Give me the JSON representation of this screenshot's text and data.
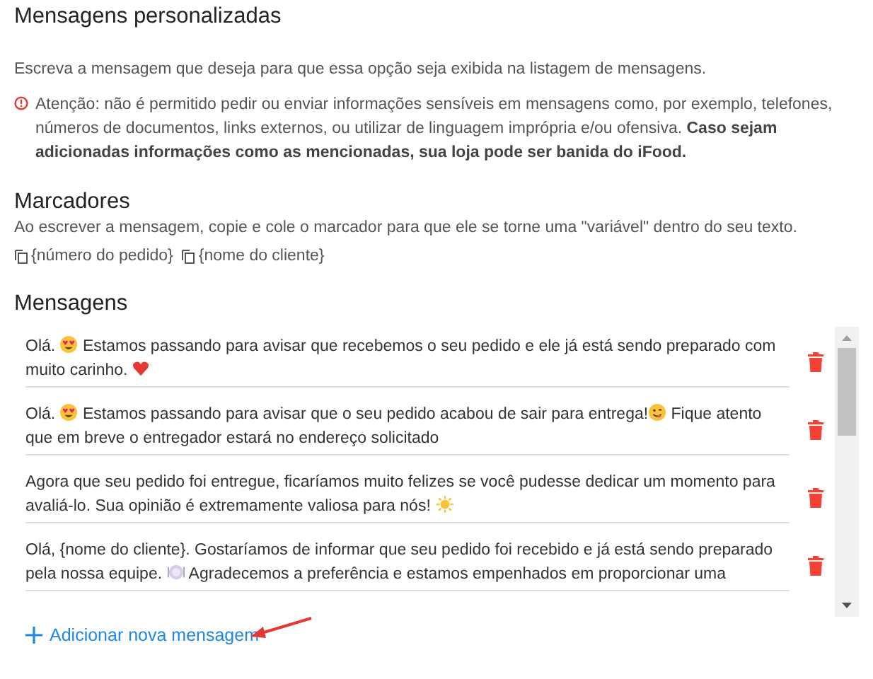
{
  "title": "Mensagens personalizadas",
  "description": "Escreva a mensagem que deseja para que essa opção seja exibida na listagem de mensagens.",
  "warning": "Atenção: não é permitido pedir ou enviar informações sensíveis em mensagens como, por exemplo, telefones, números de documentos, links externos, ou utilizar de linguagem imprópria e/ou ofensiva. **Caso sejam adicionadas informações como as mencionadas, sua loja pode ser banida do iFood.**",
  "markers": {
    "title": "Marcadores",
    "description": "Ao escrever a mensagem, copie e cole o marcador para que ele se torne uma \"variável\" dentro do seu texto.",
    "items": [
      "{número do pedido}",
      "{nome do cliente}"
    ]
  },
  "messages": {
    "title": "Mensagens",
    "items": [
      {
        "parts": [
          {
            "kind": "text",
            "text": "Olá. "
          },
          {
            "kind": "heart_eyes"
          },
          {
            "kind": "text",
            "text": " Estamos passando para avisar que recebemos o seu pedido e ele já está sendo preparado com muito carinho. "
          },
          {
            "kind": "heart"
          }
        ]
      },
      {
        "parts": [
          {
            "kind": "text",
            "text": "Olá. "
          },
          {
            "kind": "heart_eyes"
          },
          {
            "kind": "text",
            "text": " Estamos passando para avisar que o seu pedido acabou de sair para entrega!"
          },
          {
            "kind": "yum"
          },
          {
            "kind": "text",
            "text": " Fique atento que em breve o entregador estará no endereço solicitado"
          }
        ]
      },
      {
        "parts": [
          {
            "kind": "text",
            "text": "Agora que seu pedido foi entregue, ficaríamos muito felizes se você pudesse dedicar um momento para avaliá-lo. Sua opinião é extremamente valiosa para nós! "
          },
          {
            "kind": "sun"
          }
        ]
      },
      {
        "parts": [
          {
            "kind": "text",
            "text": "Olá, {nome do cliente}. Gostaríamos de informar que seu pedido foi recebido e já está sendo preparado pela nossa equipe. "
          },
          {
            "kind": "plate"
          },
          {
            "kind": "text",
            "text": " Agradecemos a preferência e estamos empenhados em proporcionar uma"
          }
        ]
      }
    ]
  },
  "add_button": "Adicionar nova mensagem"
}
